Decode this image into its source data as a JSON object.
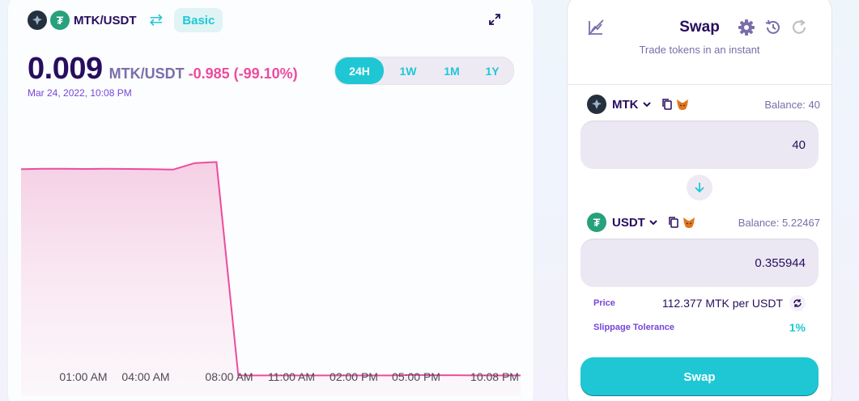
{
  "pair": {
    "name": "MTK/USDT",
    "mode_label": "Basic"
  },
  "price": {
    "value": "0.009",
    "pair_label": "MTK/USDT",
    "change": "-0.985 (-99.10%)",
    "date": "Mar 24, 2022, 10:08 PM"
  },
  "ranges": [
    "24H",
    "1W",
    "1M",
    "1Y"
  ],
  "active_range": "24H",
  "chart_data": {
    "type": "area",
    "x_ticks": [
      "01:00 AM",
      "04:00 AM",
      "08:00 AM",
      "11:00 AM",
      "02:00 PM",
      "05:00 PM",
      "10:08 PM"
    ],
    "values": [
      0.994,
      0.996,
      0.996,
      0.995,
      0.996,
      0.995,
      0.994,
      0.992,
      1.023,
      1.028,
      0.009,
      0.009,
      0.009,
      0.009,
      0.009,
      0.009,
      0.009,
      0.009,
      0.011,
      0.01,
      0.01,
      0.009,
      0.009,
      0.009
    ],
    "ylim": [
      -0.09,
      1.3
    ],
    "line_color": "#ed4b9e",
    "fill_color": "#f5cde3",
    "grid": false
  },
  "swap": {
    "title": "Swap",
    "subtitle": "Trade tokens in an instant",
    "from": {
      "symbol": "MTK",
      "balance": "Balance: 40",
      "amount": "40"
    },
    "to": {
      "symbol": "USDT",
      "balance": "Balance: 5.22467",
      "amount": "0.355944"
    },
    "price_label": "Price",
    "price_value": "112.377 MTK per USDT",
    "slippage_label": "Slippage Tolerance",
    "slippage_value": "1%",
    "button_label": "Swap"
  },
  "colors": {
    "primary": "#1fc7d4",
    "text": "#280d5f",
    "secondary": "#7645d9",
    "failure": "#ed4b9e"
  },
  "icons": [
    "settings-icon",
    "history-icon",
    "refresh-icon",
    "chart-disabled-icon",
    "swap-direction-icon",
    "expand-icon",
    "copy-icon",
    "metamask-icon",
    "arrow-down-icon"
  ]
}
